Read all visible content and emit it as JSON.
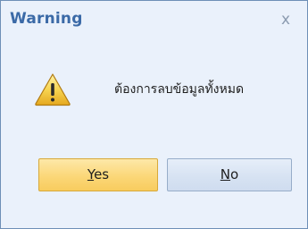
{
  "dialog": {
    "title": "Warning",
    "close_label": "x",
    "icon": "warning-icon",
    "message": "ต้องการลบข้อมูลทั้งหมด"
  },
  "buttons": {
    "yes": {
      "mnemonic": "Y",
      "rest": "es"
    },
    "no": {
      "mnemonic": "N",
      "rest": "o"
    }
  },
  "colors": {
    "title": "#3b6aa7",
    "background": "#eaf1fb",
    "yes_button": "#fbd778",
    "no_button": "#d6e2f2",
    "border": "#6e8fb7"
  }
}
